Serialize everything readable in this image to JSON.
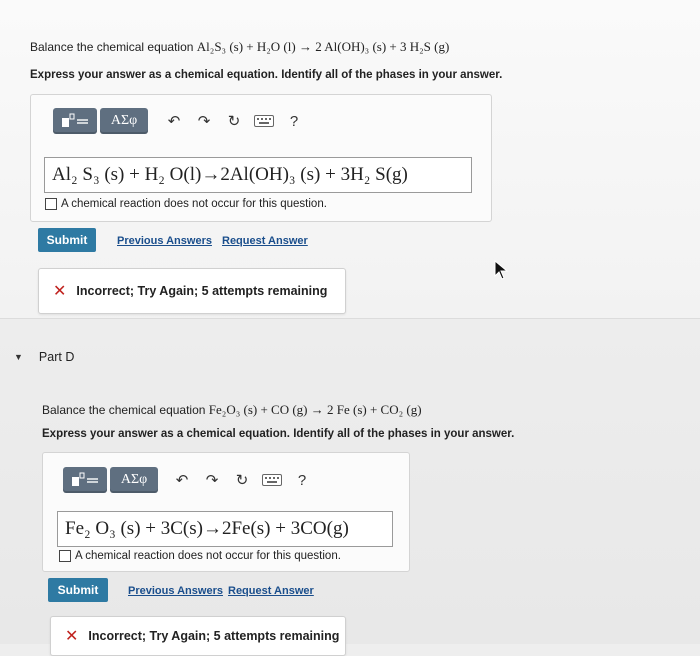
{
  "partC": {
    "question_prefix": "Balance the chemical equation ",
    "question_equation": "Al₂S₃ (s) + H₂O (l) → 2 Al(OH)₃ (s) + 3 H₂S (g)",
    "instruction": "Express your answer as a chemical equation. Identify all of the phases in your answer.",
    "answer_equation": "Al₂ S₃ (s) + H₂ O(l)→2Al(OH)₃ (s) + 3H₂ S(g)",
    "no_reaction_label": "A chemical reaction does not occur for this question.",
    "submit_label": "Submit",
    "previous_answers_label": "Previous Answers",
    "request_answer_label": "Request Answer",
    "feedback": "Incorrect; Try Again; 5 attempts remaining"
  },
  "partD": {
    "label": "Part D",
    "question_prefix": "Balance the chemical equation ",
    "question_equation": "Fe₂O₃ (s) + CO (g) → 2 Fe (s) + CO₂ (g)",
    "instruction": "Express your answer as a chemical equation. Identify all of the phases in your answer.",
    "answer_equation": "Fe₂ O₃ (s) + 3C(s)→2Fe(s) + 3CO(g)",
    "no_reaction_label": "A chemical reaction does not occur for this question.",
    "submit_label": "Submit",
    "previous_answers_label": "Previous Answers",
    "request_answer_label": "Request Answer",
    "feedback": "Incorrect; Try Again; 5 attempts remaining"
  },
  "toolbar": {
    "greek_label": "ΑΣφ",
    "undo_icon": "↶",
    "redo_icon": "↷",
    "reset_icon": "↻",
    "help_label": "?"
  },
  "icons": {
    "feedback_x": "✕",
    "collapse_caret": "▼"
  },
  "colors": {
    "submit_bg": "#2e7aa3",
    "toolbar_bg": "#5f6f80",
    "link": "#1a4e8c",
    "error_x": "#c0221e"
  }
}
